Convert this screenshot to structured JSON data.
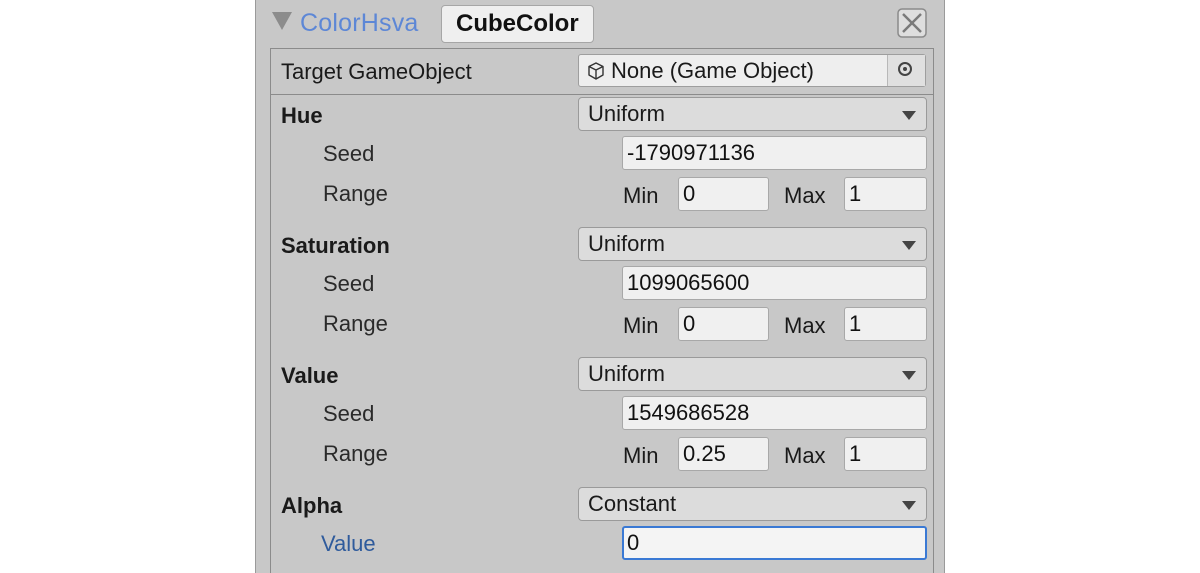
{
  "header": {
    "node_type": "ColorHsva",
    "node_name": "CubeColor",
    "close_icon": "close-x-icon"
  },
  "target": {
    "label": "Target GameObject",
    "object_value": "None (Game Object)",
    "object_icon": "cube-icon",
    "picker_icon": "object-picker-icon"
  },
  "hue": {
    "label": "Hue",
    "mode": "Uniform",
    "seed_label": "Seed",
    "seed": "-1790971136",
    "range_label": "Range",
    "min_label": "Min",
    "min": "0",
    "max_label": "Max",
    "max": "1"
  },
  "saturation": {
    "label": "Saturation",
    "mode": "Uniform",
    "seed_label": "Seed",
    "seed": "1099065600",
    "range_label": "Range",
    "min_label": "Min",
    "min": "0",
    "max_label": "Max",
    "max": "1"
  },
  "value": {
    "label": "Value",
    "mode": "Uniform",
    "seed_label": "Seed",
    "seed": "1549686528",
    "range_label": "Range",
    "min_label": "Min",
    "min": "0.25",
    "max_label": "Max",
    "max": "1"
  },
  "alpha": {
    "label": "Alpha",
    "mode": "Constant",
    "value_label": "Value",
    "value": "0"
  },
  "colors": {
    "panel_bg": "#c8c8c8",
    "node_type": "#5d87d6",
    "focus_border": "#3a79d4",
    "active_label": "#2f5b9c"
  }
}
